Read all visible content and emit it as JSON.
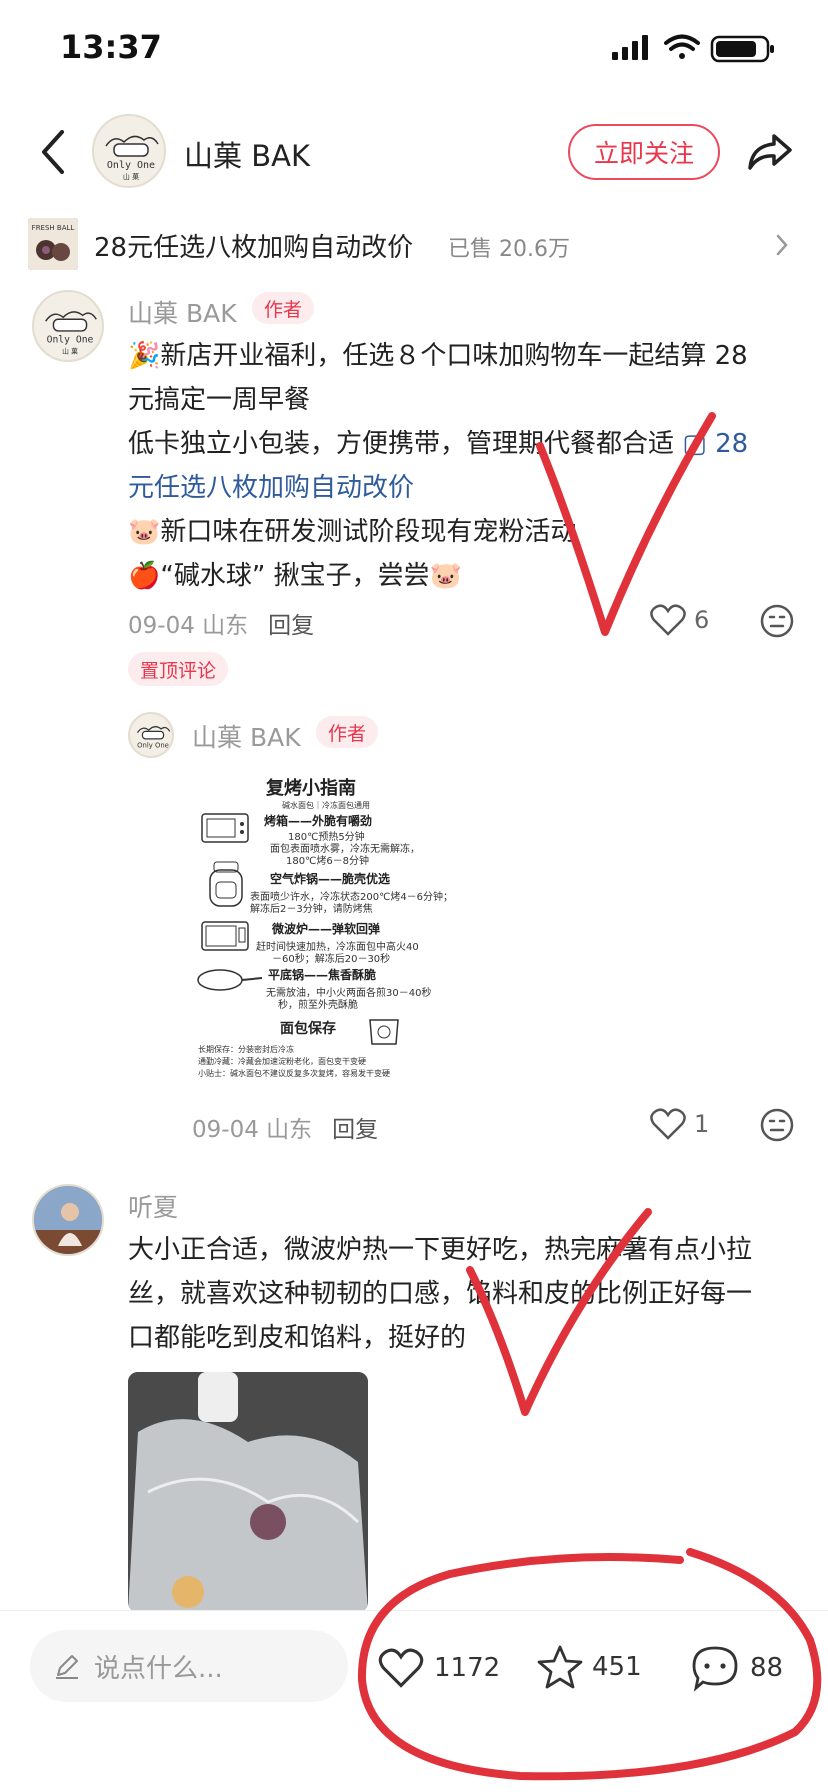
{
  "status_bar": {
    "time": "13:37"
  },
  "header": {
    "title": "山菓 BAK",
    "follow_label": "立即关注",
    "avatar_text": "Only One"
  },
  "product": {
    "title": "28元任选八枚加购自动改价",
    "sold": "已售 20.6万",
    "thumb_text": "FRESH BALL"
  },
  "comments": [
    {
      "author": "山菓 BAK",
      "tag": "作者",
      "lines": [
        "🎉新店开业福利，任选８个口味加购物车一起结算 28",
        "元搞定一周早餐",
        "低卡独立小包装，方便携带，管理期代餐都合适"
      ],
      "link_icon_label": "28",
      "link_text": "元任选八枚加购自动改价",
      "line_after_1": "🐷新口味在研发测试阶段现有宠粉活动",
      "line_after_2": "🍎“碱水球” 揪宝子，尝尝🐷",
      "meta": "09-04 山东",
      "reply": "回复",
      "likes": "6",
      "pin_label": "置顶评论"
    },
    {
      "author": "山菓 BAK",
      "tag": "作者",
      "guide_title": "复烤小指南",
      "guide_sub": "碱水面包｜冷冻面包通用",
      "guide_items": [
        "烤箱——外脆有嚼劲",
        "180℃预热5分钟",
        "面包表面喷水雾，冷冻无需解冻，",
        "180℃烤6－8分钟",
        "空气炸锅——脆壳优选",
        "表面喷少许水，冷冻状态200℃烤4－6分钟；",
        "解冻后2－3分钟，请防烤焦",
        "微波炉——弹软回弹",
        "赶时间快速加热，冷冻面包中高火40",
        "－60秒；解冻后20－30秒",
        "平底锅——焦香酥脆",
        "无需放油，中小火两面各煎30－40秒",
        "秒，煎至外壳酥脆",
        "面包保存",
        "长期保存：分装密封后冷冻",
        "通勤冷藏：冷藏会加速淀粉老化，面包变干变硬",
        "小贴士：碱水面包不建议反复多次复烤，容易发干变硬"
      ],
      "meta": "09-04 山东",
      "reply": "回复",
      "likes": "1"
    },
    {
      "author": "听夏",
      "lines": [
        "大小正合适，微波炉热一下更好吃，热完麻薯有点小拉",
        "丝，就喜欢这种韧韧的口感，馅料和皮的比例正好每一",
        "口都能吃到皮和馅料，挺好的"
      ]
    }
  ],
  "bottom_bar": {
    "input_placeholder": "说点什么...",
    "likes": "1172",
    "stars": "451",
    "comments": "88"
  },
  "colors": {
    "accent": "#e8374c",
    "link": "#2f5b9c",
    "annotation": "#e0323a"
  }
}
